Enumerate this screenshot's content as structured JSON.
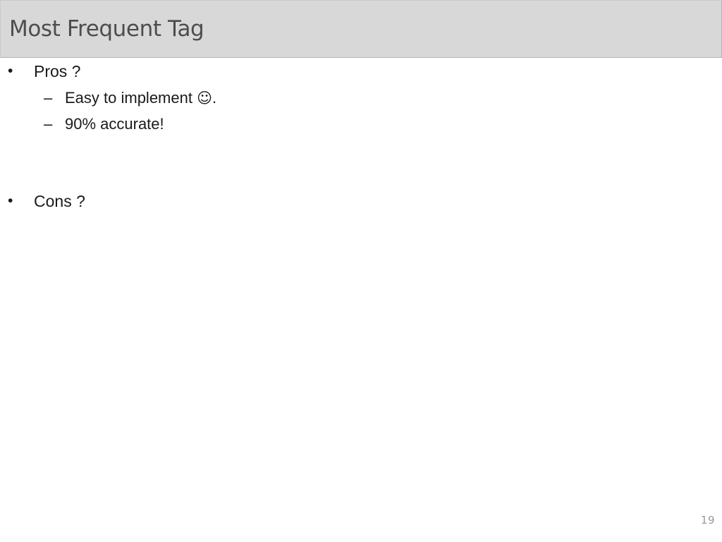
{
  "slide": {
    "title": "Most Frequent Tag",
    "page_number": "19",
    "colors": {
      "title_bar_fill": "#d8d8d8",
      "title_bar_border": "#b3b3b3",
      "title_text": "#4d4d4d",
      "body_text": "#1a1a1a",
      "page_number_text": "#999999",
      "background": "#ffffff"
    },
    "body": {
      "items": [
        {
          "level": 1,
          "marker": "•",
          "text": "Pros ?"
        },
        {
          "level": 2,
          "marker": "–",
          "text": "Easy to implement ",
          "smiley": "☺",
          "text_after": "."
        },
        {
          "level": 2,
          "marker": "–",
          "text": "90% accurate!"
        },
        {
          "level": 1,
          "marker": "•",
          "text": "Cons ?"
        }
      ]
    }
  }
}
